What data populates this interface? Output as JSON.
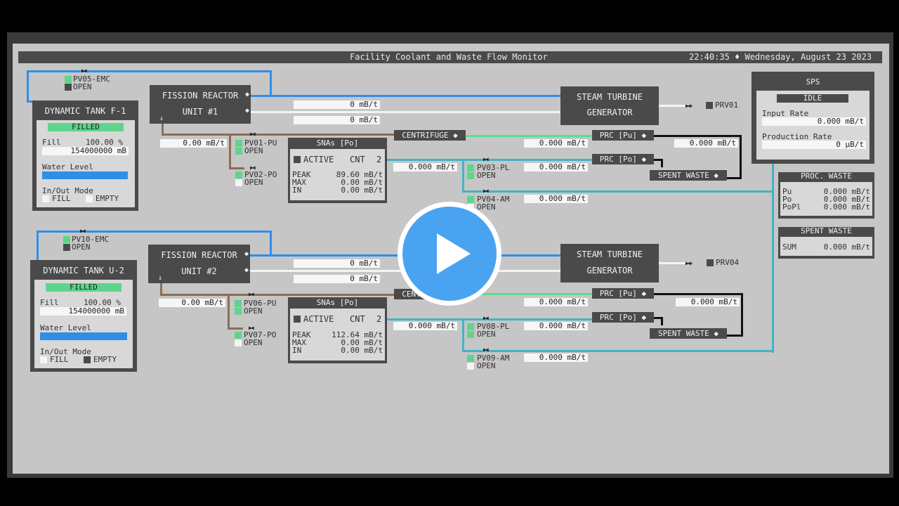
{
  "header": {
    "title": "Facility Coolant and Waste Flow Monitor",
    "datetime": "22:40:35 ♦ Wednesday, August 23 2023"
  },
  "units": {
    "flow": "mB/t",
    "prod": "µB/t"
  },
  "tank1": {
    "title": "DYNAMIC TANK F-1",
    "status": "FILLED",
    "fill_label": "Fill",
    "fill_pct": "100.00 %",
    "fill_amount": "154000000 mB",
    "water_label": "Water Level",
    "water_level": 1.0,
    "mode_label": "In/Out Mode",
    "fill_opt": "FILL",
    "empty_opt": "EMPTY",
    "valve": "PV05-EMC",
    "valve_state": "OPEN"
  },
  "tank2": {
    "title": "DYNAMIC TANK U-2",
    "status": "FILLED",
    "fill_label": "Fill",
    "fill_pct": "100.00 %",
    "fill_amount": "154000000 mB",
    "water_label": "Water Level",
    "water_level": 1.0,
    "mode_label": "In/Out Mode",
    "fill_opt": "FILL",
    "empty_opt": "EMPTY",
    "valve": "PV10-EMC",
    "valve_state": "OPEN"
  },
  "reactor1": {
    "line1": "FISSION REACTOR",
    "line2": "UNIT #1",
    "out_flow": "0.00 mB/t",
    "coolant_flow": "0 mB/t",
    "steam_flow": "0 mB/t",
    "pv_pu": "PV01-PU",
    "pv_po": "PV02-PO",
    "state": "OPEN"
  },
  "reactor2": {
    "line1": "FISSION REACTOR",
    "line2": "UNIT #2",
    "out_flow": "0.00 mB/t",
    "coolant_flow": "0 mB/t",
    "steam_flow": "0 mB/t",
    "pv_pu": "PV06-PU",
    "pv_po": "PV07-PO",
    "state": "OPEN"
  },
  "sna1": {
    "title": "SNAs [Po]",
    "active": "ACTIVE",
    "cnt_label": "CNT",
    "cnt": "2",
    "peak_label": "PEAK",
    "max_label": "MAX",
    "in_label": "IN",
    "peak": "89.60 mB/t",
    "max": "0.00 mB/t",
    "in": "0.00 mB/t",
    "out_flow": "0.000 mB/t"
  },
  "sna2": {
    "title": "SNAs [Po]",
    "active": "ACTIVE",
    "cnt_label": "CNT",
    "cnt": "2",
    "peak_label": "PEAK",
    "max_label": "MAX",
    "in_label": "IN",
    "peak": "112.64 mB/t",
    "max": "0.00 mB/t",
    "in": "0.00 mB/t",
    "out_flow": "0.000 mB/t"
  },
  "turbine1": {
    "line1": "STEAM TURBINE",
    "line2": "GENERATOR",
    "prv": "PRV01"
  },
  "turbine2": {
    "line1": "STEAM TURBINE",
    "line2": "GENERATOR",
    "prv": "PRV04"
  },
  "proc1": {
    "centrifuge": "CENTRIFUGE ◆",
    "prc_pu": "PRC [Pu] ◆",
    "prc_po": "PRC [Po] ◆",
    "spent": "SPENT WASTE ◆",
    "pu_flow": "0.000 mB/t",
    "po_flow": "0.000 mB/t",
    "spent_flow": "0.000 mB/t",
    "pv_pl": "PV03-PL",
    "pv_pl_flow": "0.000 mB/t",
    "pv_am": "PV04-AM",
    "pv_am_flow": "0.000 mB/t",
    "state": "OPEN"
  },
  "proc2": {
    "centrifuge": "CENTRIFUGE ◆",
    "prc_pu": "PRC [Pu] ◆",
    "prc_po": "PRC [Po] ◆",
    "spent": "SPENT WASTE ◆",
    "pu_flow": "0.000 mB/t",
    "po_flow": "0.000 mB/t",
    "spent_flow": "0.000 mB/t",
    "pv_pl": "PV08-PL",
    "pv_pl_flow": "0.000 mB/t",
    "pv_am": "PV09-AM",
    "pv_am_flow": "0.000 mB/t",
    "state": "OPEN"
  },
  "sps": {
    "title": "SPS",
    "status": "IDLE",
    "input_label": "Input Rate",
    "input": "0.000 mB/t",
    "prod_label": "Production Rate",
    "prod": "0 µB/t"
  },
  "proc_waste": {
    "title": "PROC. WASTE",
    "pu_label": "Pu",
    "po_label": "Po",
    "popl_label": "PoPl",
    "pu": "0.000 mB/t",
    "po": "0.000 mB/t",
    "popl": "0.000 mB/t"
  },
  "spent_waste": {
    "title": "SPENT WASTE",
    "sum_label": "SUM",
    "sum": "0.000 mB/t"
  },
  "colors": {
    "coolant": "#2f8fe8",
    "steam": "#f4f4f4",
    "waste": "#8a6e52",
    "polonium": "#43b3c6",
    "plutonium": "#5fdc8c",
    "spent": "#111111",
    "play_button": "#4aa3f0"
  }
}
